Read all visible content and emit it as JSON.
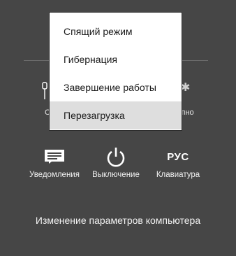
{
  "menu": {
    "items": [
      {
        "label": "Спящий режим"
      },
      {
        "label": "Гибернация"
      },
      {
        "label": "Завершение работы"
      },
      {
        "label": "Перезагрузка"
      }
    ]
  },
  "partial_labels": {
    "left": "С",
    "right": "упно"
  },
  "tiles": [
    {
      "label": "Уведомления",
      "icon": "notifications-icon"
    },
    {
      "label": "Выключение",
      "icon": "power-icon"
    },
    {
      "label": "Клавиатура",
      "glyph": "РУС"
    }
  ],
  "settings_link": "Изменение параметров компьютера",
  "colors": {
    "background": "#464646",
    "menu_bg": "#ffffff",
    "menu_hover": "#dedede"
  }
}
